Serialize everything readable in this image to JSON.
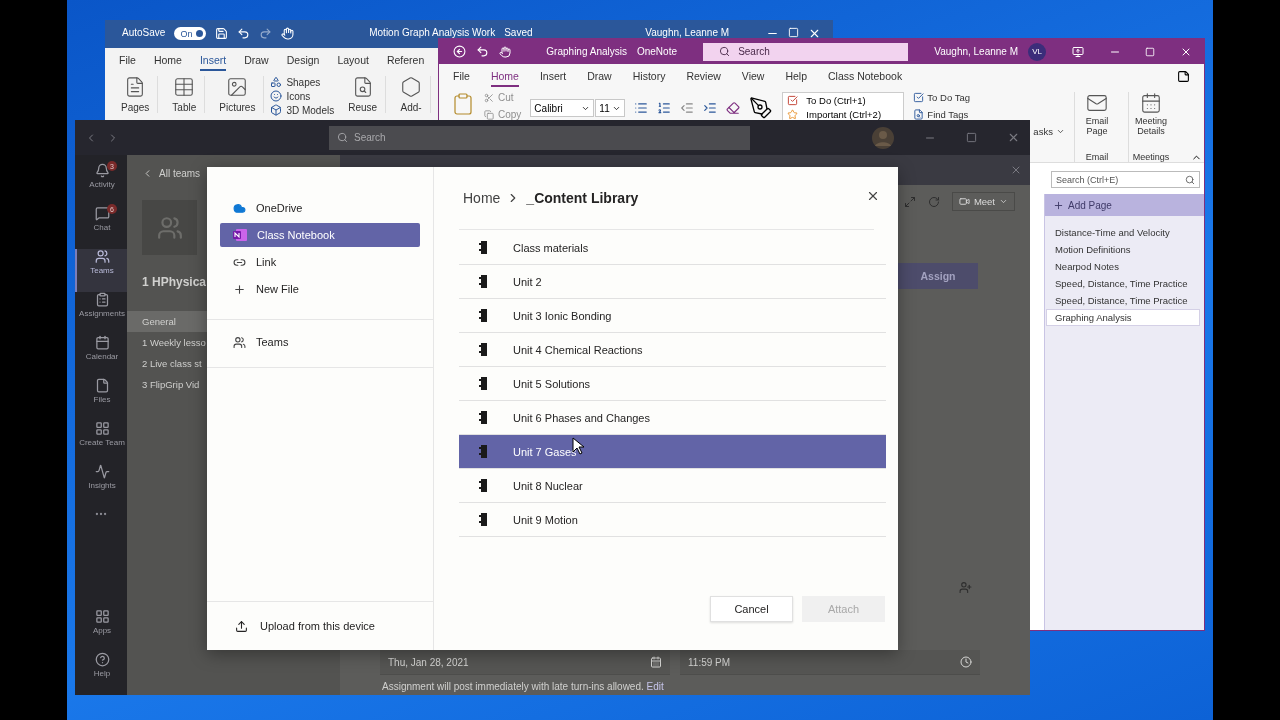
{
  "word": {
    "autosave": {
      "label": "AutoSave",
      "state": "On",
      "on": true
    },
    "title": "Motion Graph Analysis Work",
    "status": "Saved",
    "user": "Vaughn, Leanne M",
    "tabs": [
      {
        "label": "File",
        "selected": false
      },
      {
        "label": "Home",
        "selected": false
      },
      {
        "label": "Insert",
        "selected": true
      },
      {
        "label": "Draw",
        "selected": false
      },
      {
        "label": "Design",
        "selected": false
      },
      {
        "label": "Layout",
        "selected": false
      },
      {
        "label": "Referen",
        "selected": false
      }
    ],
    "ribbon": [
      {
        "kind": "large",
        "label": "Pages"
      },
      {
        "kind": "large",
        "label": "Table"
      },
      {
        "kind": "large",
        "label": "Pictures"
      },
      {
        "kind": "stack",
        "items": [
          "Shapes",
          "Icons",
          "3D Models"
        ]
      },
      {
        "kind": "large",
        "label": "Reuse"
      },
      {
        "kind": "large",
        "label": "Add-"
      }
    ]
  },
  "onenote": {
    "title": "Graphing Analysis",
    "app": "OneNote",
    "search": {
      "placeholder": "Search"
    },
    "user": "Vaughn, Leanne M",
    "initials": "VL",
    "tabs": [
      {
        "label": "File",
        "selected": false
      },
      {
        "label": "Home",
        "selected": true
      },
      {
        "label": "Insert",
        "selected": false
      },
      {
        "label": "Draw",
        "selected": false
      },
      {
        "label": "History",
        "selected": false
      },
      {
        "label": "Review",
        "selected": false
      },
      {
        "label": "View",
        "selected": false
      },
      {
        "label": "Help",
        "selected": false
      },
      {
        "label": "Class Notebook",
        "selected": false
      }
    ],
    "clipboard": [
      {
        "label": "Cut",
        "disabled": true
      },
      {
        "label": "Copy",
        "disabled": true
      }
    ],
    "font": "Calibri",
    "size": "11",
    "tags": [
      {
        "label": "To Do (Ctrl+1)",
        "kind": "check"
      },
      {
        "label": "Important (Ctrl+2)",
        "kind": "star"
      }
    ],
    "tag_actions": [
      {
        "label": "To Do Tag",
        "kind": "check"
      },
      {
        "label": "Find Tags",
        "kind": "find"
      }
    ],
    "tasks": "asks",
    "groups": [
      {
        "button": "Email Page",
        "label": "Email",
        "kind": "mail"
      },
      {
        "button": "Meeting Details",
        "label": "Meetings",
        "kind": "meeting"
      }
    ],
    "page_search": {
      "placeholder": "Search (Ctrl+E)"
    },
    "add_page": "Add Page",
    "pages": [
      {
        "title": "Distance-Time and Velocity",
        "selected": false
      },
      {
        "title": "Motion Definitions",
        "selected": false
      },
      {
        "title": "Nearpod Notes",
        "selected": false
      },
      {
        "title": "Speed, Distance, Time Practice",
        "selected": false
      },
      {
        "title": "Speed, Distance, Time Practice",
        "selected": false
      },
      {
        "title": "Graphing Analysis",
        "selected": true
      }
    ]
  },
  "teams": {
    "search": {
      "placeholder": "Search"
    },
    "rail": [
      {
        "label": "Activity",
        "badge": "3",
        "selected": false
      },
      {
        "label": "Chat",
        "badge": "6",
        "selected": false
      },
      {
        "label": "Teams",
        "selected": true
      },
      {
        "label": "Assignments",
        "selected": false
      },
      {
        "label": "Calendar",
        "selected": false
      },
      {
        "label": "Files",
        "selected": false
      },
      {
        "label": "Create Team",
        "selected": false
      },
      {
        "label": "Insights",
        "selected": false
      }
    ],
    "rail_bottom": [
      {
        "label": "Apps",
        "selected": false
      },
      {
        "label": "Help",
        "selected": false
      }
    ],
    "back": "All teams",
    "team": "1 HPhysica",
    "channels": [
      {
        "name": "General",
        "selected": true
      },
      {
        "name": "1 Weekly lesso",
        "selected": false
      },
      {
        "name": "2 Live class st",
        "selected": false
      },
      {
        "name": "3 FlipGrip Vid",
        "selected": false
      }
    ],
    "meet": "Meet",
    "assign": "Assign",
    "due_date": "Thu, Jan 28, 2021",
    "due_time": "11:59 PM",
    "note": "Assignment will post immediately with late turn-ins allowed.",
    "edit": "Edit"
  },
  "dialog": {
    "sources": [
      {
        "label": "OneDrive",
        "kind": "location",
        "selected": false
      },
      {
        "label": "Class Notebook",
        "kind": "location",
        "selected": true
      },
      {
        "label": "Link",
        "kind": "location",
        "selected": false
      },
      {
        "label": "New File",
        "kind": "location",
        "selected": false
      },
      {
        "label": "Teams",
        "kind": "team",
        "selected": false
      }
    ],
    "upload": "Upload from this device",
    "breadcrumb": [
      "Home",
      "_Content Library"
    ],
    "folders": [
      {
        "name": "Class materials",
        "selected": false
      },
      {
        "name": "Unit 2",
        "selected": false
      },
      {
        "name": "Unit 3 Ionic Bonding",
        "selected": false
      },
      {
        "name": "Unit 4 Chemical Reactions",
        "selected": false
      },
      {
        "name": "Unit 5 Solutions",
        "selected": false
      },
      {
        "name": "Unit 6 Phases and Changes",
        "selected": false
      },
      {
        "name": "Unit 7 Gases",
        "selected": true
      },
      {
        "name": "Unit 8 Nuclear",
        "selected": false
      },
      {
        "name": "Unit 9 Motion",
        "selected": false
      }
    ],
    "actions": [
      {
        "label": "Cancel",
        "disabled": false
      },
      {
        "label": "Attach",
        "disabled": true
      }
    ]
  }
}
